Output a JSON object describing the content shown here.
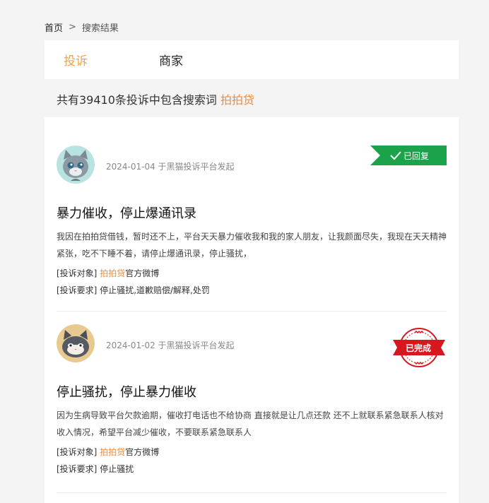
{
  "breadcrumb": {
    "home": "首页",
    "separator": ">",
    "current": "搜索结果"
  },
  "tabs": [
    {
      "label": "投诉"
    },
    {
      "label": "商家"
    }
  ],
  "summary": {
    "prefix": "共有39410条投诉中包含搜索词 ",
    "keyword": "拍拍贷"
  },
  "colors": {
    "accent": "#f08b3a",
    "tab_active": "#f7a440",
    "replied_green": "#1aa34a",
    "done_red": "#d6181e"
  },
  "complaints": [
    {
      "avatar": "cat-avatar-gray",
      "date": "2024-01-04 于黑猫投诉平台发起",
      "status": "已回复",
      "title": "暴力催收，停止爆通讯录",
      "desc": "我因在拍拍贷借钱，暂时还不上，平台天天暴力催收我和我的家人朋友，让我颜面尽失，我现在天天精神紧张，吃不下睡不着，请停止爆通讯录，停止骚扰，",
      "target_label": "[投诉对象]",
      "target_name": "拍拍贷",
      "target_suffix": "官方微博",
      "demand_label": "[投诉要求]",
      "demand": "停止骚扰,道歉赔偿/解释,处罚"
    },
    {
      "avatar": "cat-avatar-tan",
      "date": "2024-01-02 于黑猫投诉平台发起",
      "status": "已完成",
      "title": "停止骚扰，停止暴力催收",
      "desc": "因为生病导致平台欠款逾期，催收打电话也不给协商 直接就是让几点还款 还不上就联系紧急联系人核对收入情况，希望平台减少催收，不要联系紧急联系人",
      "target_label": "[投诉对象]",
      "target_name": "拍拍贷",
      "target_suffix": "官方微博",
      "demand_label": "[投诉要求]",
      "demand": "停止骚扰"
    }
  ]
}
